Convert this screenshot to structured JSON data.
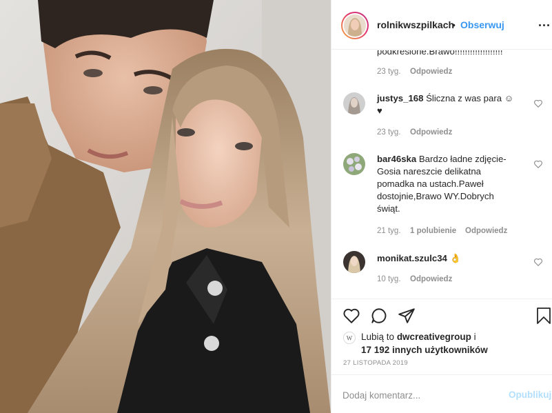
{
  "header": {
    "username": "rolnikwszpilkach",
    "separator": "•",
    "follow_label": "Obserwuj",
    "more_label": "..."
  },
  "comments": [
    {
      "partial_text": "podkreślone.Brawo!!!!!!!!!!!!!!!!!!!",
      "time": "23 tyg.",
      "reply_label": "Odpowiedz"
    },
    {
      "username": "justys_168",
      "text": "Śliczna z was para ☺",
      "text_line2": "♥",
      "time": "23 tyg.",
      "reply_label": "Odpowiedz"
    },
    {
      "username": "bar46ska",
      "text_line1": "Bardzo ładne zdjęcie-",
      "text_line2": "Gosia nareszcie delikatna",
      "text_line3": "pomadka na ustach.Paweł",
      "text_line4": "dostojnie,Brawo WY.Dobrych",
      "text_line5": "świąt.",
      "time": "21 tyg.",
      "likes": "1 polubienie",
      "reply_label": "Odpowiedz"
    },
    {
      "username": "monikat.szulc34",
      "text": "👌",
      "time": "10 tyg.",
      "reply_label": "Odpowiedz"
    }
  ],
  "likes": {
    "prefix": "Lubią to",
    "liker": "dwcreativegroup",
    "conj": "i",
    "others": "17 192 innych użytkowników"
  },
  "date": "27 LISTOPADA 2019",
  "add_comment": {
    "placeholder": "Dodaj komentarz...",
    "publish_label": "Opublikuj"
  },
  "icons": {
    "like": "heart-icon",
    "comment": "comment-icon",
    "share": "share-icon",
    "save": "bookmark-icon"
  },
  "colors": {
    "accent": "#3897f0",
    "muted": "#8e8e8e",
    "publish_disabled": "#b2dffc"
  }
}
